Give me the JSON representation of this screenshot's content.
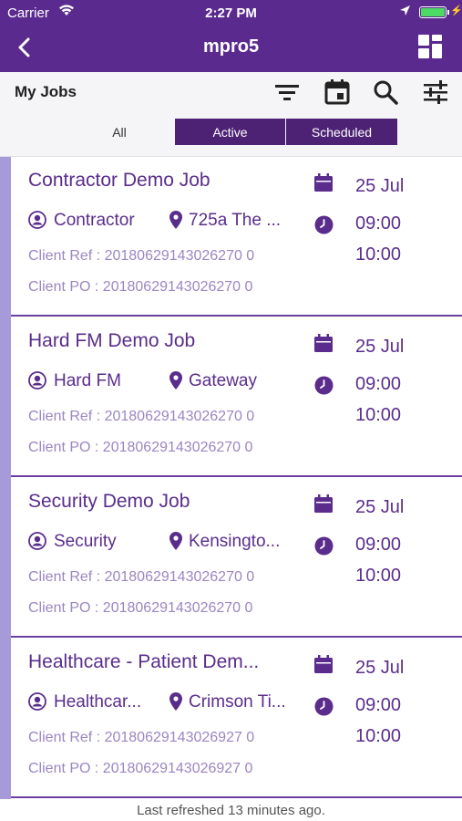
{
  "status_bar": {
    "carrier": "Carrier",
    "time": "2:27 PM"
  },
  "nav": {
    "title": "mpro5"
  },
  "toolbar": {
    "title": "My Jobs"
  },
  "tabs": [
    {
      "label": "All",
      "selected": false
    },
    {
      "label": "Active",
      "selected": true
    },
    {
      "label": "Scheduled",
      "selected": true
    }
  ],
  "jobs": [
    {
      "title": "Contractor Demo Job",
      "category": "Contractor",
      "location": "725a The ...",
      "client_ref": "Client Ref : 20180629143026270 0",
      "client_po": "Client PO : 20180629143026270 0",
      "date": "25 Jul",
      "start": "09:00",
      "end": "10:00"
    },
    {
      "title": "Hard FM Demo Job",
      "category": "Hard FM",
      "location": "Gateway",
      "client_ref": "Client Ref : 20180629143026270 0",
      "client_po": "Client PO : 20180629143026270 0",
      "date": "25 Jul",
      "start": "09:00",
      "end": "10:00"
    },
    {
      "title": "Security Demo Job",
      "category": "Security",
      "location": "Kensingto...",
      "client_ref": "Client Ref : 20180629143026270 0",
      "client_po": "Client PO : 20180629143026270 0",
      "date": "25 Jul",
      "start": "09:00",
      "end": "10:00"
    },
    {
      "title": "Healthcare - Patient Dem...",
      "category": "Healthcar...",
      "location": "Crimson Ti...",
      "client_ref": "Client Ref : 20180629143026927 0",
      "client_po": "Client PO : 20180629143026927 0",
      "date": "25 Jul",
      "start": "09:00",
      "end": "10:00"
    }
  ],
  "footer": {
    "text": "Last refreshed 13 minutes ago."
  },
  "colors": {
    "header": "#5b2a8e",
    "accent": "#5a2d8c",
    "muted": "#9b86c2",
    "segment_active": "#4d2275",
    "list_strip": "#a79ad9"
  }
}
